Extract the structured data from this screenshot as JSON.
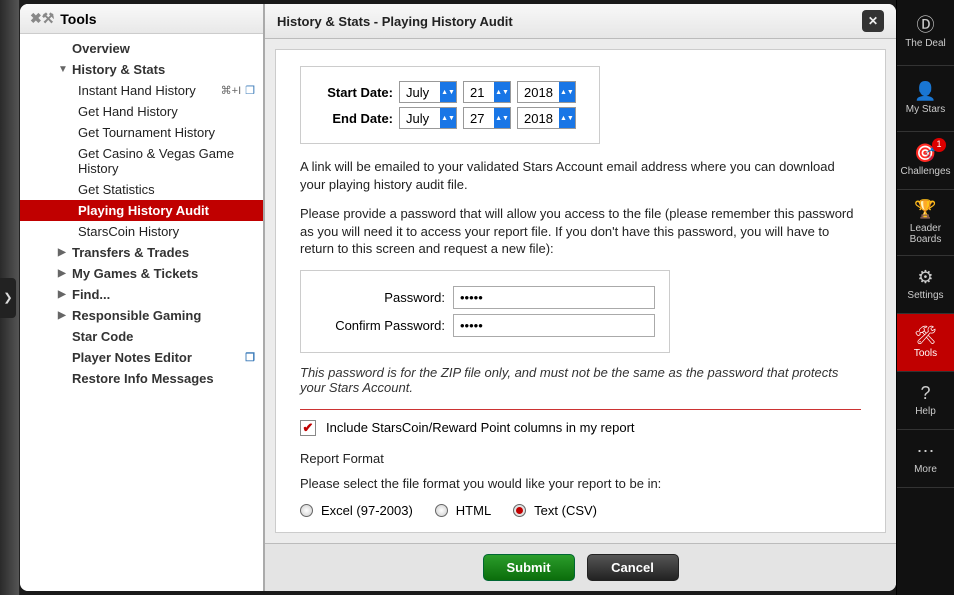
{
  "sidebar": {
    "title": "Tools",
    "items": [
      {
        "label": "Overview"
      },
      {
        "label": "History & Stats",
        "expanded": true,
        "children": [
          {
            "label": "Instant Hand History",
            "shortcut": "⌘+I",
            "icon": true
          },
          {
            "label": "Get Hand History"
          },
          {
            "label": "Get Tournament History"
          },
          {
            "label": "Get Casino & Vegas Game History"
          },
          {
            "label": "Get Statistics"
          },
          {
            "label": "Playing History Audit",
            "selected": true
          },
          {
            "label": "StarsCoin History"
          }
        ]
      },
      {
        "label": "Transfers & Trades",
        "expandable": true
      },
      {
        "label": "My Games & Tickets",
        "expandable": true
      },
      {
        "label": "Find...",
        "expandable": true
      },
      {
        "label": "Responsible Gaming",
        "expandable": true
      },
      {
        "label": "Star Code"
      },
      {
        "label": "Player Notes Editor",
        "icon": true
      },
      {
        "label": "Restore Info Messages"
      }
    ]
  },
  "panel": {
    "title": "History & Stats - Playing History Audit",
    "start_label": "Start Date:",
    "end_label": "End Date:",
    "start": {
      "month": "July",
      "day": "21",
      "year": "2018"
    },
    "end": {
      "month": "July",
      "day": "27",
      "year": "2018"
    },
    "text1": "A link will be emailed to your validated Stars Account email address where you can download your playing history audit file.",
    "text2": "Please provide a password that will allow you access to the file (please remember this password as you will need it to access your report file. If you don't have this password, you will have to return to this screen and request a new file):",
    "pw_label": "Password:",
    "cpw_label": "Confirm Password:",
    "pw_value": "•••••",
    "hint": "This password is for the ZIP file only, and must not be the same as the password that protects your Stars Account.",
    "include_label": "Include StarsCoin/Reward Point columns in my report",
    "include_checked": true,
    "format_heading": "Report Format",
    "format_prompt": "Please select the file format you would like your report to be in:",
    "formats": [
      {
        "label": "Excel (97-2003)",
        "selected": false
      },
      {
        "label": "HTML",
        "selected": false
      },
      {
        "label": "Text (CSV)",
        "selected": true
      }
    ],
    "submit": "Submit",
    "cancel": "Cancel"
  },
  "rail": {
    "items": [
      {
        "label": "The Deal",
        "icon": "Ⓓ"
      },
      {
        "label": "My Stars",
        "icon": "👤"
      },
      {
        "label": "Challenges",
        "icon": "🎯",
        "badge": "1"
      },
      {
        "label": "Leader Boards",
        "icon": "🏆"
      },
      {
        "label": "Settings",
        "icon": "⚙"
      },
      {
        "label": "Tools",
        "icon": "🛠",
        "active": true
      },
      {
        "label": "Help",
        "icon": "?"
      },
      {
        "label": "More",
        "icon": "⋯"
      }
    ]
  }
}
